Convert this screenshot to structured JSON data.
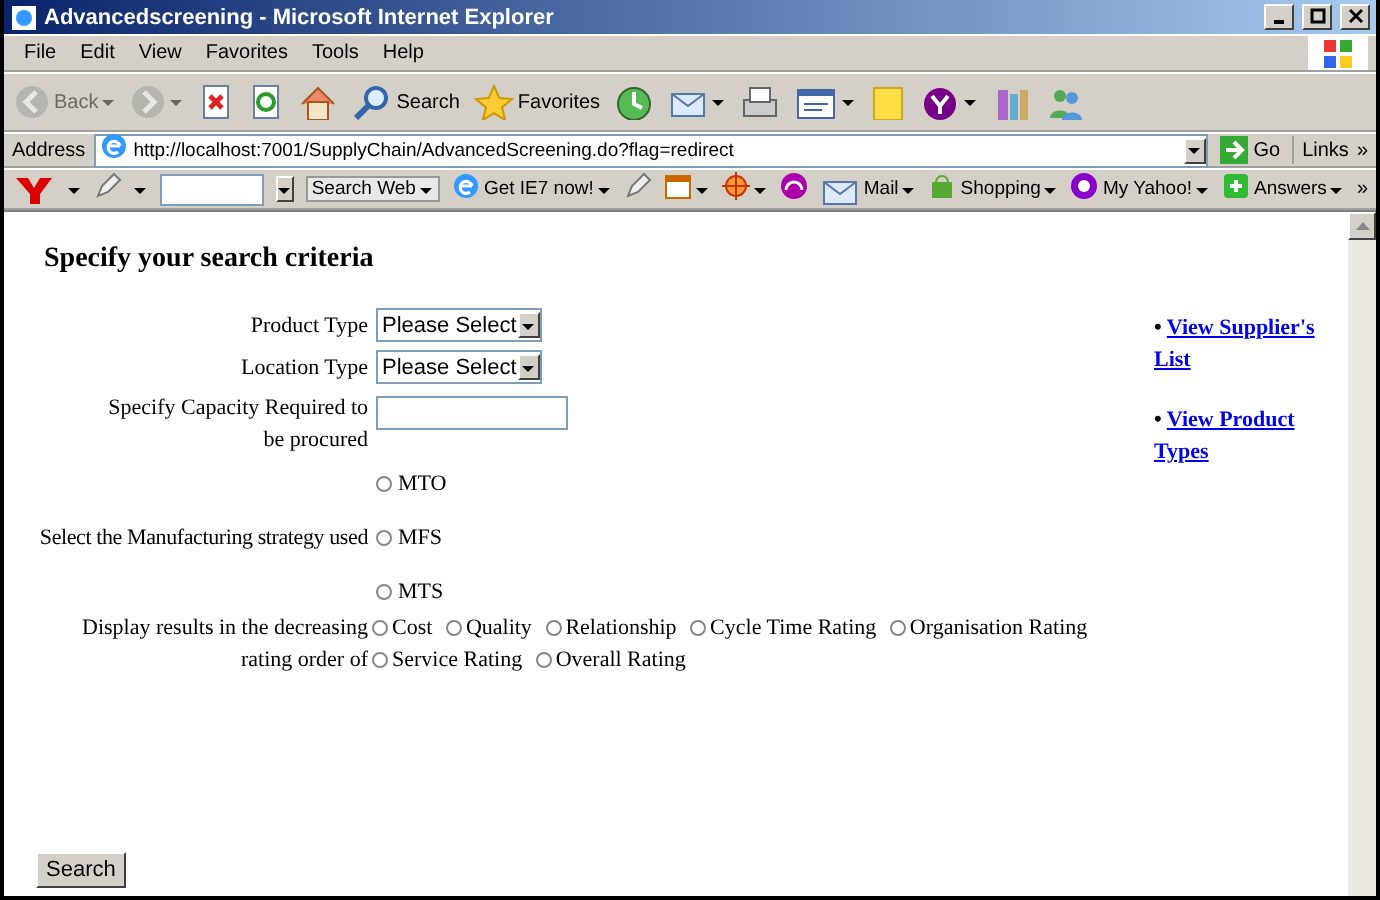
{
  "window": {
    "title": "Advancedscreening - Microsoft Internet Explorer"
  },
  "menu": [
    "File",
    "Edit",
    "View",
    "Favorites",
    "Tools",
    "Help"
  ],
  "toolbar": [
    {
      "kind": "back",
      "label": "Back",
      "disabled": true
    },
    {
      "kind": "forward",
      "disabled": true
    },
    {
      "kind": "stop",
      "disabled": false
    },
    {
      "kind": "refresh",
      "disabled": false
    },
    {
      "kind": "home",
      "disabled": false
    },
    {
      "kind": "search",
      "label": "Search",
      "disabled": false
    },
    {
      "kind": "favorites",
      "label": "Favorites",
      "disabled": false
    },
    {
      "kind": "history",
      "disabled": false
    },
    {
      "kind": "mail",
      "disabled": false
    },
    {
      "kind": "print",
      "disabled": false
    },
    {
      "kind": "edit",
      "disabled": false
    },
    {
      "kind": "note",
      "disabled": false
    },
    {
      "kind": "yahoo",
      "disabled": false
    },
    {
      "kind": "research",
      "disabled": false
    },
    {
      "kind": "messenger",
      "disabled": false
    }
  ],
  "address": {
    "label": "Address",
    "url": "http://localhost:7001/SupplyChain/AdvancedScreening.do?flag=redirect",
    "go": "Go",
    "links": "Links",
    "chevron": "»"
  },
  "yahoo_bar": {
    "items": [
      {
        "kind": "search-web",
        "label": "Search Web"
      },
      {
        "kind": "ie",
        "label": "Get IE7 now!"
      },
      {
        "kind": "pencil"
      },
      {
        "kind": "calendar"
      },
      {
        "kind": "target"
      },
      {
        "kind": "headphones"
      },
      {
        "kind": "mail",
        "label": "Mail"
      },
      {
        "kind": "shopping",
        "label": "Shopping"
      },
      {
        "kind": "myyahoo",
        "label": "My Yahoo!"
      },
      {
        "kind": "answers",
        "label": "Answers"
      }
    ],
    "chevron": "»"
  },
  "form": {
    "heading": "Specify your search criteria",
    "fields": [
      {
        "kind": "select",
        "label": "Product Type",
        "value": "Please Select"
      },
      {
        "kind": "select",
        "label": "Location Type",
        "value": "Please Select"
      },
      {
        "kind": "text",
        "label": "Specify Capacity Required to be procured"
      },
      {
        "kind": "radio-stack",
        "label": "Select the Manufacturing strategy used",
        "options": [
          {
            "label": "MTO",
            "selected": false
          },
          {
            "label": "MFS",
            "selected": false
          },
          {
            "label": "MTS",
            "selected": false
          }
        ]
      },
      {
        "kind": "radio-flow",
        "label": "Display results in the decreasing rating order of",
        "options": [
          {
            "label": "Cost",
            "selected": false
          },
          {
            "label": "Quality",
            "selected": false
          },
          {
            "label": "Relationship",
            "selected": false
          },
          {
            "label": "Cycle Time Rating",
            "selected": false
          },
          {
            "label": "Organisation Rating",
            "selected": false
          },
          {
            "label": "Service Rating",
            "selected": false
          },
          {
            "label": "Overall Rating",
            "selected": false
          }
        ]
      }
    ],
    "links": [
      {
        "bullet": "•",
        "label": "View Supplier's List"
      },
      {
        "bullet": "•",
        "label": "View Product Types"
      }
    ],
    "button": "Search"
  }
}
